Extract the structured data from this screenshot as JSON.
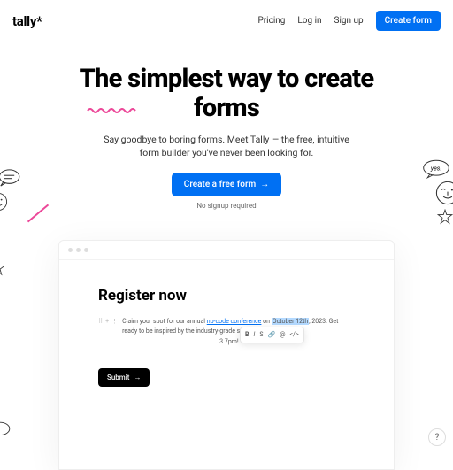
{
  "brand": "tally*",
  "nav": {
    "pricing": "Pricing",
    "login": "Log in",
    "signup": "Sign up",
    "create": "Create form"
  },
  "hero": {
    "title": "The simplest way to create forms",
    "sub": "Say goodbye to boring forms. Meet Tally — the free, intuitive form builder you've never been looking for.",
    "cta": "Create a free form",
    "note": "No signup required"
  },
  "preview": {
    "title": "Register now",
    "text1": "Claim your spot for our annual ",
    "link": "no-code conference",
    "text2": " on ",
    "highlight": "October 12th",
    "text3": ", 2023. Get ready to be inspired by the industry-grade speakers and learn from",
    "text4": "3.7pm!",
    "submit": "Submit"
  },
  "toolbar": {
    "b": "B",
    "i": "I",
    "s": "S",
    "link": "🔗",
    "mention": "@",
    "code": "</>"
  },
  "bubble_yes": "yes!",
  "help": "?"
}
